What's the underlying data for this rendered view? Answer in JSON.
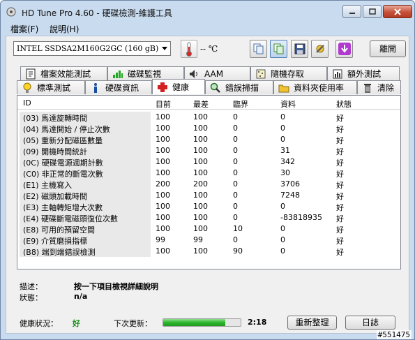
{
  "window": {
    "title": "HD Tune Pro 4.60 - 硬碟檢測-維護工具"
  },
  "menu": [
    {
      "label": "檔案(F)"
    },
    {
      "label": "說明(H)"
    }
  ],
  "toolbar": {
    "drive": "INTEL SSDSA2M160G2GC (160 gB)",
    "temperature": "-- ℃",
    "exit_label": "離開"
  },
  "tabs_top": [
    {
      "label": "檔案效能測試",
      "icon": "file-benchmark-icon"
    },
    {
      "label": "磁碟監視",
      "icon": "disk-monitor-icon"
    },
    {
      "label": "AAM",
      "icon": "speaker-icon"
    },
    {
      "label": "隨機存取",
      "icon": "random-access-icon"
    },
    {
      "label": "額外測試",
      "icon": "extra-tests-icon"
    }
  ],
  "tabs_bottom": [
    {
      "label": "標準測試",
      "icon": "lightbulb-icon"
    },
    {
      "label": "硬碟資訊",
      "icon": "info-icon"
    },
    {
      "label": "健康",
      "icon": "health-cross-icon",
      "selected": true
    },
    {
      "label": "錯誤掃描",
      "icon": "magnifier-icon"
    },
    {
      "label": "資料夾使用率",
      "icon": "folder-icon"
    },
    {
      "label": "清除",
      "icon": "trash-icon"
    }
  ],
  "health": {
    "columns": [
      "ID",
      "目前",
      "最差",
      "臨界",
      "資料",
      "狀態"
    ],
    "rows": [
      [
        "(03) 馬達旋轉時間",
        "100",
        "100",
        "0",
        "0",
        "好"
      ],
      [
        "(04) 馬達開始 / 停止次數",
        "100",
        "100",
        "0",
        "0",
        "好"
      ],
      [
        "(05) 重新分配磁區數量",
        "100",
        "100",
        "0",
        "0",
        "好"
      ],
      [
        "(09) 開機時間統計",
        "100",
        "100",
        "0",
        "31",
        "好"
      ],
      [
        "(0C) 硬碟電源週期計數",
        "100",
        "100",
        "0",
        "342",
        "好"
      ],
      [
        "(C0) 非正常的斷電次數",
        "100",
        "100",
        "0",
        "30",
        "好"
      ],
      [
        "(E1) 主機寫入",
        "200",
        "200",
        "0",
        "3706",
        "好"
      ],
      [
        "(E2) 磁頭加載時間",
        "100",
        "100",
        "0",
        "7248",
        "好"
      ],
      [
        "(E3) 主軸轉矩增大次數",
        "100",
        "100",
        "0",
        "0",
        "好"
      ],
      [
        "(E4) 硬碟斷電磁頭復位次數",
        "100",
        "100",
        "0",
        "-83818935",
        "好"
      ],
      [
        "(E8) 可用的預留空間",
        "100",
        "100",
        "10",
        "0",
        "好"
      ],
      [
        "(E9) 介質磨損指標",
        "99",
        "99",
        "0",
        "0",
        "好"
      ],
      [
        "(B8) 端到端錯誤檢測",
        "100",
        "100",
        "90",
        "0",
        "好"
      ]
    ]
  },
  "info": {
    "desc_label": "描述：",
    "desc_value": "按一下項目檢視詳細說明",
    "status_label": "狀態：",
    "status_value": "n/a"
  },
  "status": {
    "health_label": "健康狀況：",
    "health_value": "好",
    "next_update_label": "下次更新：",
    "progress": 0.8,
    "timer": "2:18",
    "refresh_label": "重新整理",
    "log_label": "日誌"
  },
  "watermark": "#551475",
  "colors": {
    "good": "#1a8f1a",
    "accent": "#3a7bd5"
  }
}
